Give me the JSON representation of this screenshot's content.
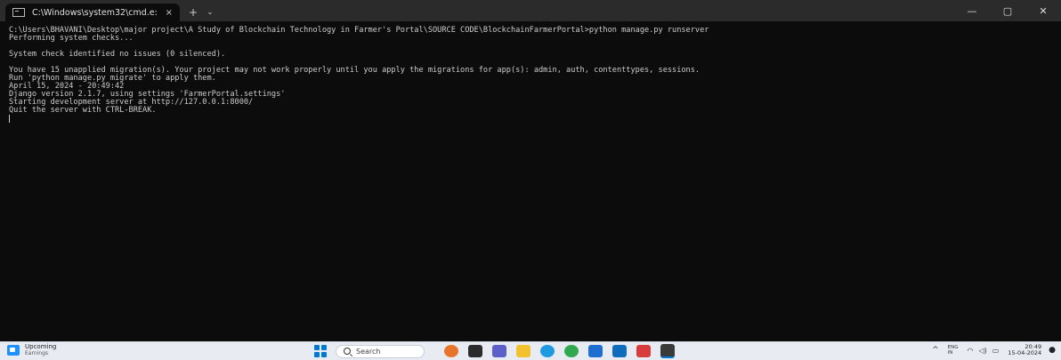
{
  "window": {
    "tab_title": "C:\\Windows\\system32\\cmd.e:",
    "tab_close": "×",
    "new_tab": "+",
    "tab_dropdown": "⌄",
    "minimize": "—",
    "maximize": "▢",
    "close": "✕"
  },
  "console": {
    "lines": [
      "C:\\Users\\BHAVANI\\Desktop\\major project\\A Study of Blockchain Technology in Farmer's Portal\\SOURCE CODE\\BlockchainFarmerPortal>python manage.py runserver",
      "Performing system checks...",
      "",
      "System check identified no issues (0 silenced).",
      "",
      "You have 15 unapplied migration(s). Your project may not work properly until you apply the migrations for app(s): admin, auth, contenttypes, sessions.",
      "Run 'python manage.py migrate' to apply them.",
      "April 15, 2024 - 20:49:42",
      "Django version 2.1.7, using settings 'FarmerPortal.settings'",
      "Starting development server at http://127.0.0.1:8000/",
      "Quit the server with CTRL-BREAK."
    ]
  },
  "taskbar": {
    "weather_title": "Upcoming",
    "weather_sub": "Earnings",
    "search_placeholder": "Search",
    "apps": [
      {
        "icon": "flower-widget-icon",
        "color": "#e8732a"
      },
      {
        "icon": "task-view-icon",
        "color": "#2b2b2b"
      },
      {
        "icon": "chat-icon",
        "color": "#5b5fc7"
      },
      {
        "icon": "file-explorer-icon",
        "color": "#f2c12e"
      },
      {
        "icon": "edge-icon",
        "color": "#1e9be0"
      },
      {
        "icon": "chrome-icon",
        "color": "#2fa84f"
      },
      {
        "icon": "store-icon",
        "color": "#1c6fd1"
      },
      {
        "icon": "mail-icon",
        "color": "#0f6cbd"
      },
      {
        "icon": "wps-icon",
        "color": "#d83b3b"
      },
      {
        "icon": "terminal-icon",
        "color": "#3a3a3a"
      }
    ],
    "tray_chevron": "^",
    "lang_top": "ENG",
    "lang_bottom": "IN",
    "wifi": "◠",
    "volume": "◁)",
    "battery": "▭",
    "time": "20:49",
    "date": "15-04-2024",
    "bell": "●"
  }
}
